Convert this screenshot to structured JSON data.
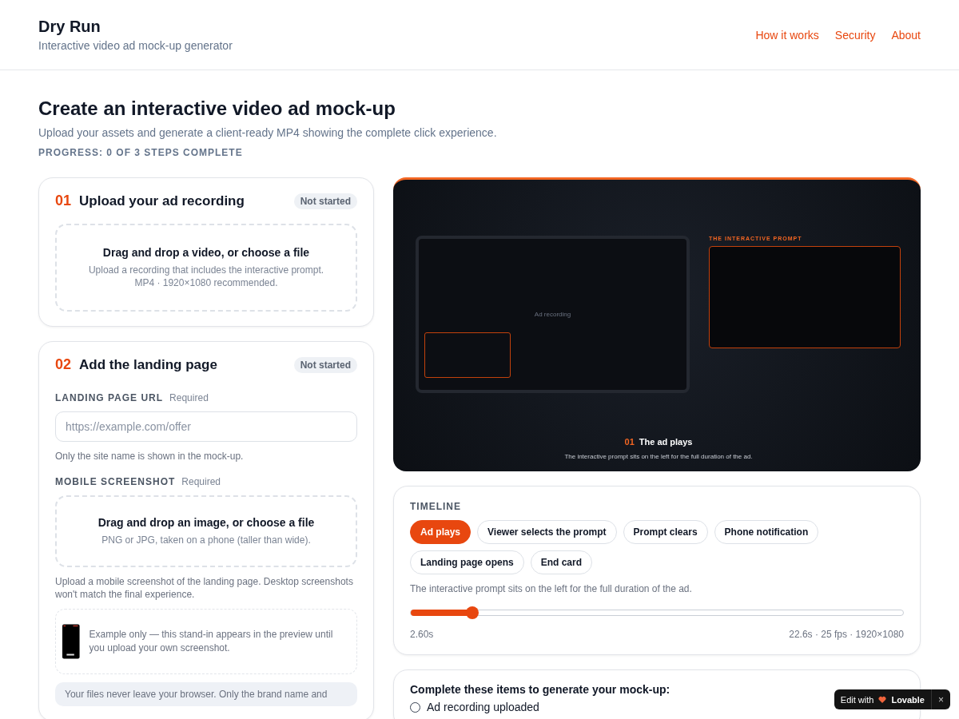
{
  "header": {
    "title": "Dry Run",
    "subtitle": "Interactive video ad mock-up generator",
    "nav": [
      "How it works",
      "Security",
      "About"
    ]
  },
  "intro": {
    "title": "Create an interactive video ad mock-up",
    "subtitle": "Upload your assets and generate a client-ready MP4 showing the complete click experience.",
    "progress": "PROGRESS: 0 OF 3 STEPS COMPLETE"
  },
  "step1": {
    "number": "01",
    "title": "Upload your ad recording",
    "status": "Not started",
    "dropzone": {
      "title": "Drag and drop a video, or choose a file",
      "hint": "Upload a recording that includes the interactive prompt.\nMP4 · 1920×1080 recommended."
    }
  },
  "step2": {
    "number": "02",
    "title": "Add the landing page",
    "status": "Not started",
    "url_field": {
      "label": "LANDING PAGE URL",
      "required": "Required",
      "placeholder": "https://example.com/offer",
      "help": "Only the site name is shown in the mock-up."
    },
    "screenshot": {
      "label": "MOBILE SCREENSHOT",
      "required": "Required",
      "dropzone": {
        "title": "Drag and drop an image, or choose a file",
        "hint": "PNG or JPG, taken on a phone (taller than wide)."
      },
      "help": "Upload a mobile screenshot of the landing page. Desktop screenshots won't match the final experience.",
      "example": "Example only — this stand-in appears in the preview until you upload your own screenshot."
    },
    "notice": "Your files never leave your browser. Only the brand name and"
  },
  "preview": {
    "recording_label": "Ad recording",
    "prompt_label": "THE INTERACTIVE PROMPT",
    "step_number": "01",
    "step_title": "The ad plays",
    "caption": "The interactive prompt sits on the left for the full duration of the ad."
  },
  "timeline": {
    "title": "TIMELINE",
    "chips": [
      {
        "label": "Ad plays",
        "selected": true
      },
      {
        "label": "Viewer selects the prompt",
        "selected": false
      },
      {
        "label": "Prompt clears",
        "selected": false
      },
      {
        "label": "Phone notification",
        "selected": false
      },
      {
        "label": "Landing page opens",
        "selected": false
      },
      {
        "label": "End card",
        "selected": false
      }
    ],
    "description": "The interactive prompt sits on the left for the full duration of the ad.",
    "scrubber": {
      "level": 0.125
    },
    "time": "2.60s",
    "meta": "22.6s · 25 fps · 1920×1080"
  },
  "checklist": {
    "title": "Complete these items to generate your mock-up:",
    "items": [
      {
        "label": "Ad recording uploaded",
        "checked": false
      }
    ]
  },
  "badge": {
    "prefix": "Edit with",
    "brand": "Lovable",
    "close": "×"
  }
}
